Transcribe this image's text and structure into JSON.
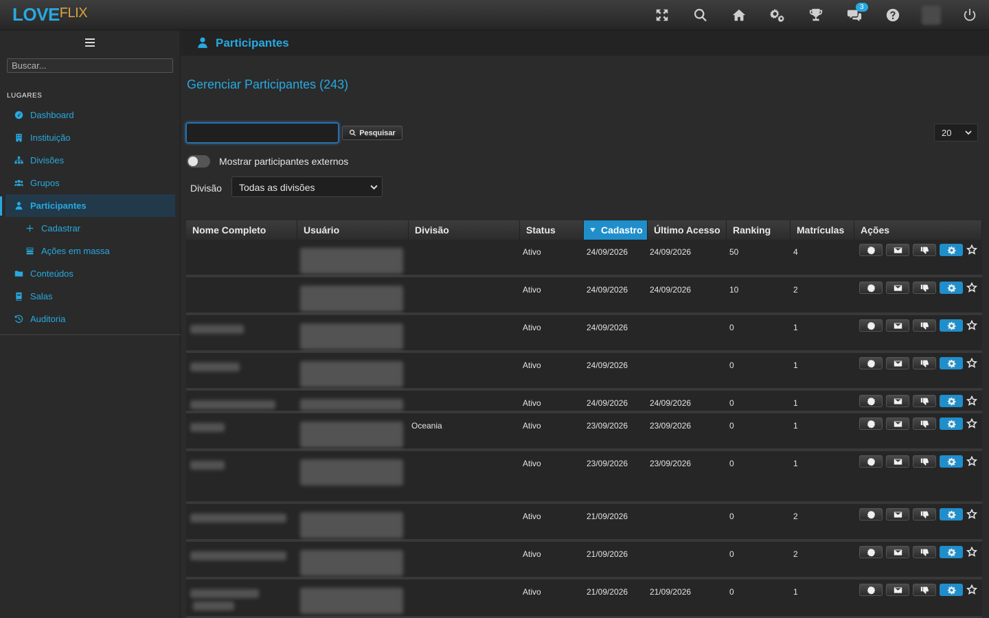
{
  "app": {
    "logo_part1": "LOVE",
    "logo_part2": "FLIX"
  },
  "topbar": {
    "icons": [
      "fullscreen-icon",
      "search-icon",
      "home-icon",
      "gears-icon",
      "trophy-icon",
      "chat-icon",
      "help-icon",
      "avatar",
      "power-icon"
    ],
    "notification_count": "3"
  },
  "sidebar": {
    "search_placeholder": "Buscar...",
    "section_label": "LUGARES",
    "items": [
      {
        "label": "Dashboard",
        "icon": "dashboard-icon"
      },
      {
        "label": "Instituição",
        "icon": "building-icon"
      },
      {
        "label": "Divisões",
        "icon": "sitemap-icon"
      },
      {
        "label": "Grupos",
        "icon": "users-icon"
      },
      {
        "label": "Participantes",
        "icon": "user-icon",
        "active": true
      },
      {
        "label": "Cadastrar",
        "icon": "plus-icon",
        "sub": true
      },
      {
        "label": "Ações em massa",
        "icon": "tasks-icon",
        "sub": true
      },
      {
        "label": "Conteúdos",
        "icon": "folder-icon"
      },
      {
        "label": "Salas",
        "icon": "book-icon"
      },
      {
        "label": "Auditoria",
        "icon": "history-icon"
      }
    ]
  },
  "header": {
    "title": "Participantes"
  },
  "main": {
    "title": "Gerenciar Participantes (243)",
    "search_button": "Pesquisar",
    "search_value": "",
    "per_page": "20",
    "toggle_label": "Mostrar participantes externos",
    "toggle_on": false,
    "division_label": "Divisão",
    "division_selected": "Todas as divisões"
  },
  "table": {
    "columns": [
      "Nome Completo",
      "Usuário",
      "Divisão",
      "Status",
      "Cadastro",
      "Último Acesso",
      "Ranking",
      "Matrículas",
      "Ações"
    ],
    "sorted_column": "Cadastro",
    "rows": [
      {
        "divisao": "",
        "status": "Ativo",
        "cadastro": "24/09/2026",
        "ultimo_acesso": "24/09/2026",
        "ranking": "50",
        "matriculas": "4"
      },
      {
        "divisao": "",
        "status": "Ativo",
        "cadastro": "24/09/2026",
        "ultimo_acesso": "24/09/2026",
        "ranking": "10",
        "matriculas": "2"
      },
      {
        "divisao": "",
        "status": "Ativo",
        "cadastro": "24/09/2026",
        "ultimo_acesso": "",
        "ranking": "0",
        "matriculas": "1"
      },
      {
        "divisao": "",
        "status": "Ativo",
        "cadastro": "24/09/2026",
        "ultimo_acesso": "",
        "ranking": "0",
        "matriculas": "1"
      },
      {
        "divisao": "",
        "status": "Ativo",
        "cadastro": "24/09/2026",
        "ultimo_acesso": "24/09/2026",
        "ranking": "0",
        "matriculas": "1"
      },
      {
        "divisao": "Oceania",
        "status": "Ativo",
        "cadastro": "23/09/2026",
        "ultimo_acesso": "23/09/2026",
        "ranking": "0",
        "matriculas": "1"
      },
      {
        "divisao": "",
        "status": "Ativo",
        "cadastro": "23/09/2026",
        "ultimo_acesso": "23/09/2026",
        "ranking": "0",
        "matriculas": "1"
      },
      {
        "divisao": "",
        "status": "Ativo",
        "cadastro": "21/09/2026",
        "ultimo_acesso": "",
        "ranking": "0",
        "matriculas": "2"
      },
      {
        "divisao": "",
        "status": "Ativo",
        "cadastro": "21/09/2026",
        "ultimo_acesso": "",
        "ranking": "0",
        "matriculas": "2"
      },
      {
        "divisao": "",
        "status": "Ativo",
        "cadastro": "21/09/2026",
        "ultimo_acesso": "21/09/2026",
        "ranking": "0",
        "matriculas": "1"
      }
    ],
    "row_actions": [
      "badge-icon",
      "envelope-icon",
      "thumbs-down-icon",
      "settings-icon",
      "star-icon"
    ]
  },
  "colors": {
    "accent": "#27a9e1",
    "sorted_header": "#1f8ecb",
    "background": "#2b2b2b"
  }
}
